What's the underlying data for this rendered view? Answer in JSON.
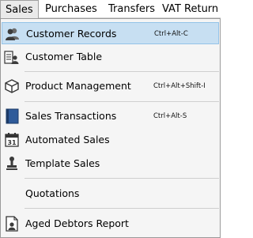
{
  "menubar": {
    "items": [
      {
        "label": "Sales"
      },
      {
        "label": "Purchases"
      },
      {
        "label": "Transfers"
      },
      {
        "label": "VAT Return"
      }
    ]
  },
  "dropdown": {
    "items": [
      {
        "label": "Customer Records",
        "shortcut": "Ctrl+Alt-C",
        "icon": "customers-icon",
        "highlighted": true
      },
      {
        "label": "Customer Table",
        "shortcut": "",
        "icon": "customer-table-icon"
      },
      {
        "label": "Product Management",
        "shortcut": "Ctrl+Alt+Shift-I",
        "icon": "product-box-icon"
      },
      {
        "label": "Sales Transactions",
        "shortcut": "Ctrl+Alt-S",
        "icon": "ledger-book-icon"
      },
      {
        "label": "Automated Sales",
        "shortcut": "",
        "icon": "calendar-icon",
        "icon_text": "31"
      },
      {
        "label": "Template Sales",
        "shortcut": "",
        "icon": "stamp-icon"
      },
      {
        "label": "Quotations",
        "shortcut": "",
        "icon": ""
      },
      {
        "label": "Aged Debtors Report",
        "shortcut": "",
        "icon": "report-icon"
      }
    ]
  },
  "colors": {
    "highlight_bg": "#c7dff2",
    "highlight_border": "#94c3e8",
    "menu_bg": "#f5f5f5"
  }
}
